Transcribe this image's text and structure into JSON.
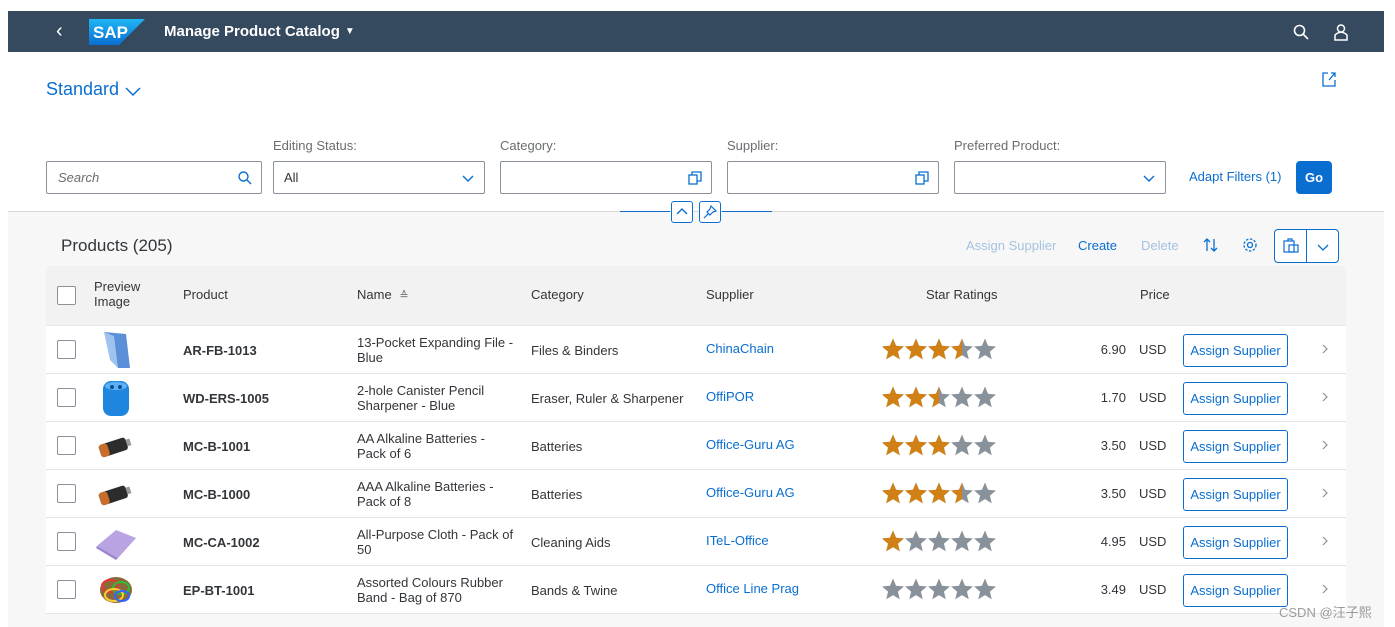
{
  "shell": {
    "back": "‹",
    "logo": "SAP",
    "title": "Manage Product Catalog",
    "search_icon": "search-icon",
    "user_icon": "user-icon"
  },
  "header": {
    "variant": "Standard",
    "share_icon": "share-icon"
  },
  "filters": {
    "search_placeholder": "Search",
    "editing_status_label": "Editing Status:",
    "editing_status_value": "All",
    "category_label": "Category:",
    "supplier_label": "Supplier:",
    "preferred_label": "Preferred Product:",
    "adapt": "Adapt Filters (1)",
    "go": "Go"
  },
  "table": {
    "title": "Products (205)",
    "toolbar": {
      "assign_supplier": "Assign Supplier",
      "create": "Create",
      "delete": "Delete"
    },
    "columns": {
      "preview": "Preview Image",
      "product": "Product",
      "name": "Name",
      "category": "Category",
      "supplier": "Supplier",
      "rating": "Star Ratings",
      "price": "Price"
    },
    "row_action": "Assign Supplier",
    "rows": [
      {
        "product": "AR-FB-1013",
        "name": "13-Pocket Expanding File - Blue",
        "category": "Files & Binders",
        "supplier": "ChinaChain",
        "rating": 3.5,
        "price": "6.90",
        "currency": "USD",
        "image": "file-folder"
      },
      {
        "product": "WD-ERS-1005",
        "name": "2-hole Canister Pencil Sharpener - Blue",
        "category": "Eraser, Ruler & Sharpener",
        "supplier": "OffiPOR",
        "rating": 2.5,
        "price": "1.70",
        "currency": "USD",
        "image": "sharpener"
      },
      {
        "product": "MC-B-1001",
        "name": "AA Alkaline Batteries - Pack of 6",
        "category": "Batteries",
        "supplier": "Office-Guru AG",
        "rating": 3,
        "price": "3.50",
        "currency": "USD",
        "image": "battery"
      },
      {
        "product": "MC-B-1000",
        "name": "AAA Alkaline Batteries - Pack of 8",
        "category": "Batteries",
        "supplier": "Office-Guru AG",
        "rating": 3.5,
        "price": "3.50",
        "currency": "USD",
        "image": "battery"
      },
      {
        "product": "MC-CA-1002",
        "name": "All-Purpose Cloth - Pack of 50",
        "category": "Cleaning Aids",
        "supplier": "ITeL-Office",
        "rating": 1,
        "price": "4.95",
        "currency": "USD",
        "image": "cloth"
      },
      {
        "product": "EP-BT-1001",
        "name": "Assorted Colours Rubber Band - Bag of 870",
        "category": "Bands & Twine",
        "supplier": "Office Line Prag",
        "rating": 0,
        "price": "3.49",
        "currency": "USD",
        "image": "rubber-bands"
      }
    ]
  },
  "watermark": "CSDN @汪子熙",
  "colors": {
    "shell": "#354a5f",
    "accent": "#0a6ed1",
    "star": "#d08014",
    "star_empty": "#89919a"
  }
}
